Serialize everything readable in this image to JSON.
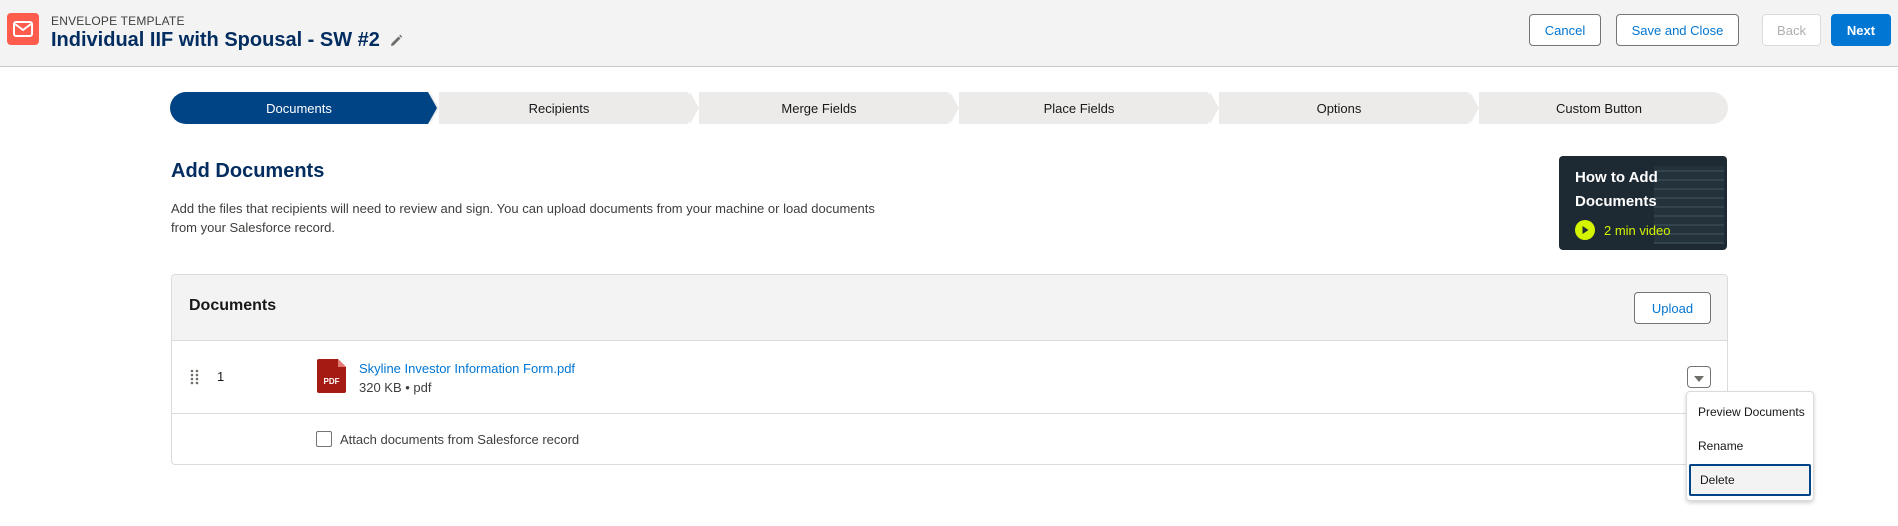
{
  "header": {
    "eyebrow": "ENVELOPE TEMPLATE",
    "title": "Individual IIF with Spousal - SW #2",
    "app_icon": "envelope-icon",
    "edit_icon": "pencil-icon",
    "buttons": {
      "cancel": "Cancel",
      "save_close": "Save and Close",
      "back": "Back",
      "next": "Next"
    }
  },
  "path": {
    "steps": [
      {
        "label": "Documents",
        "active": true
      },
      {
        "label": "Recipients",
        "active": false
      },
      {
        "label": "Merge Fields",
        "active": false
      },
      {
        "label": "Place Fields",
        "active": false
      },
      {
        "label": "Options",
        "active": false
      },
      {
        "label": "Custom Button",
        "active": false
      }
    ]
  },
  "section": {
    "title": "Add Documents",
    "description": "Add the files that recipients will need to review and sign. You can upload documents from your machine or load documents from your Salesforce record."
  },
  "video": {
    "title": "How to Add Documents",
    "duration": "2 min video",
    "icon": "play-icon"
  },
  "documents": {
    "title": "Documents",
    "upload_label": "Upload",
    "items": [
      {
        "index": "1",
        "name": "Skyline Investor Information Form.pdf",
        "meta": "320 KB • pdf",
        "icon": "pdf-file-icon",
        "badge": "PDF"
      }
    ],
    "attach_label": "Attach documents from Salesforce record",
    "attach_checked": false
  },
  "row_menu": {
    "items": [
      "Preview Documents",
      "Rename",
      "Delete"
    ],
    "focused": "Delete"
  },
  "colors": {
    "brand_blue": "#0176d3",
    "path_active": "#014486",
    "title_navy": "#032d60",
    "app_icon": "#fe5c4c",
    "video_accent": "#d4f400",
    "pdf_red": "#a61a14"
  }
}
